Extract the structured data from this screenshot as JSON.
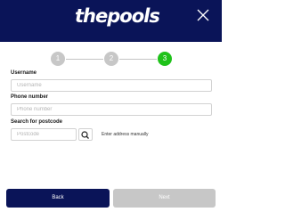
{
  "header": {
    "logo_text": "thepools"
  },
  "steps": [
    {
      "label": "1",
      "state": "done"
    },
    {
      "label": "2",
      "state": "done"
    },
    {
      "label": "3",
      "state": "active"
    }
  ],
  "form": {
    "username_label": "Username",
    "username_placeholder": "Username",
    "phone_label": "Phone number",
    "phone_placeholder": "Phone number",
    "postcode_label": "Search for postcode",
    "postcode_placeholder": "Postcode",
    "manual_address": "Enter address manually"
  },
  "buttons": {
    "back": "Back",
    "next": "Next"
  },
  "colors": {
    "brand_navy": "#0a1458",
    "active_step": "#1fc21a",
    "disabled": "#c7c7c7"
  }
}
